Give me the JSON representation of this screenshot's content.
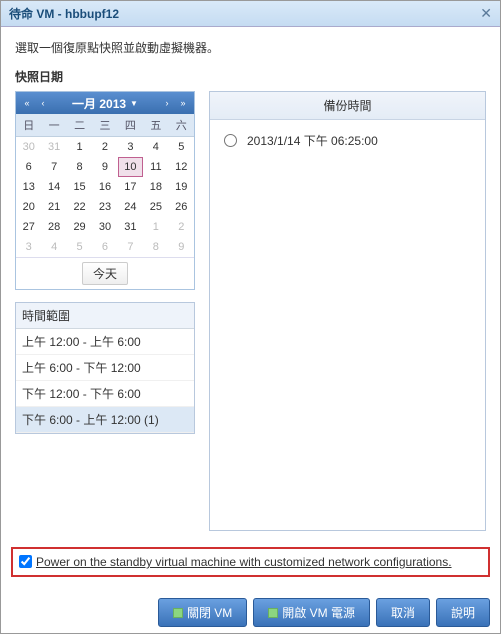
{
  "dialog": {
    "title": "待命 VM - hbbupf12"
  },
  "instruction": "選取一個復原點快照並啟動虛擬機器。",
  "snapshot_date_label": "快照日期",
  "calendar": {
    "month_label": "一月 2013",
    "dow": [
      "日",
      "一",
      "二",
      "三",
      "四",
      "五",
      "六"
    ],
    "weeks": [
      [
        "30",
        "31",
        "1",
        "2",
        "3",
        "4",
        "5"
      ],
      [
        "6",
        "7",
        "8",
        "9",
        "10",
        "11",
        "12"
      ],
      [
        "13",
        "14",
        "15",
        "16",
        "17",
        "18",
        "19"
      ],
      [
        "20",
        "21",
        "22",
        "23",
        "24",
        "25",
        "26"
      ],
      [
        "27",
        "28",
        "29",
        "30",
        "31",
        "1",
        "2"
      ],
      [
        "3",
        "4",
        "5",
        "6",
        "7",
        "8",
        "9"
      ]
    ],
    "other_month_cells": [
      [
        0,
        0
      ],
      [
        0,
        1
      ],
      [
        4,
        5
      ],
      [
        4,
        6
      ],
      [
        5,
        0
      ],
      [
        5,
        1
      ],
      [
        5,
        2
      ],
      [
        5,
        3
      ],
      [
        5,
        4
      ],
      [
        5,
        5
      ],
      [
        5,
        6
      ]
    ],
    "selected_cell": [
      1,
      4
    ],
    "today_label": "今天"
  },
  "time_range": {
    "header": "時間範圍",
    "items": [
      "上午 12:00 - 上午 6:00",
      "上午 6:00 - 下午 12:00",
      "下午 12:00 - 下午 6:00",
      "下午 6:00 - 上午 12:00 (1)"
    ],
    "selected_index": 3
  },
  "backup": {
    "header": "備份時間",
    "items": [
      {
        "time": "2013/1/14 下午 06:25:00",
        "selected": false
      }
    ]
  },
  "power_option": {
    "checked": true,
    "label": "Power on the standby virtual machine with customized network configurations."
  },
  "buttons": {
    "shutdown": "關閉 VM",
    "poweron": "開啟 VM 電源",
    "cancel": "取消",
    "help": "說明"
  }
}
